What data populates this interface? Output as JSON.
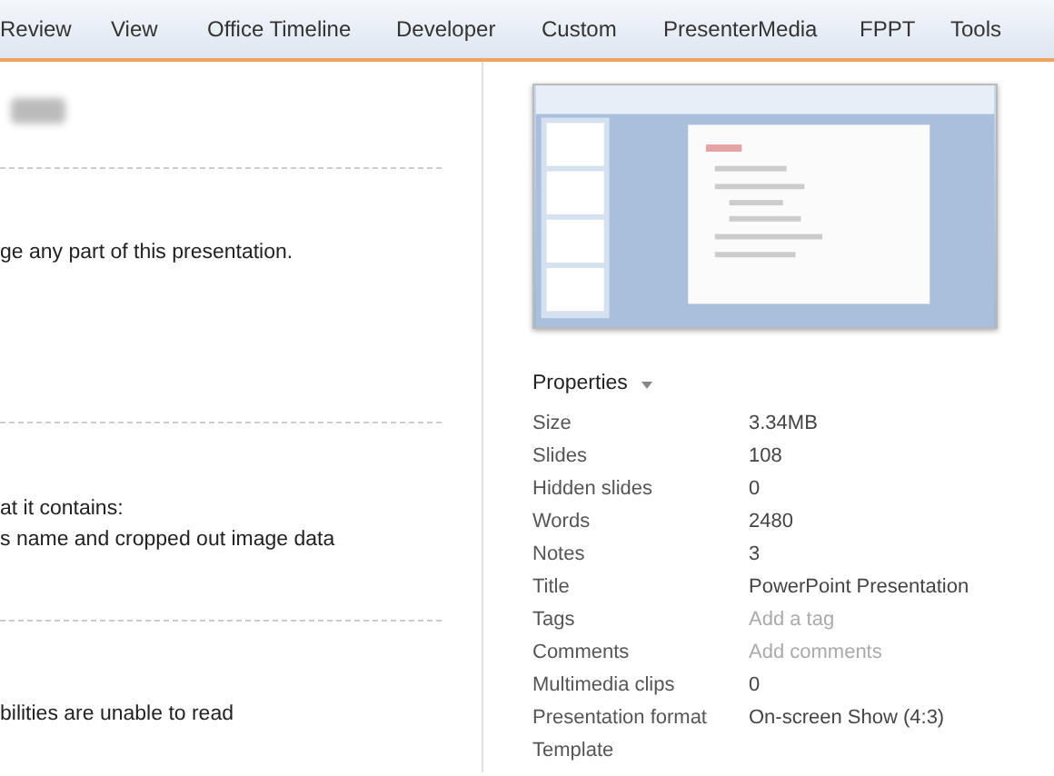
{
  "tabs": [
    {
      "label": "Review"
    },
    {
      "label": "View"
    },
    {
      "label": "Office Timeline"
    },
    {
      "label": "Developer"
    },
    {
      "label": "Custom"
    },
    {
      "label": "PresenterMedia"
    },
    {
      "label": "FPPT"
    },
    {
      "label": "Tools"
    }
  ],
  "left_pane": {
    "sections": [
      {
        "lines": [
          "ge any part of this presentation."
        ]
      },
      {
        "lines": [
          "at it contains:",
          "s name and cropped out image data"
        ]
      },
      {
        "lines": [
          "bilities are unable to read"
        ]
      }
    ]
  },
  "properties": {
    "header": "Properties",
    "rows": [
      {
        "label": "Size",
        "value": "3.34MB"
      },
      {
        "label": "Slides",
        "value": "108"
      },
      {
        "label": "Hidden slides",
        "value": "0"
      },
      {
        "label": "Words",
        "value": "2480"
      },
      {
        "label": "Notes",
        "value": "3"
      },
      {
        "label": "Title",
        "value": "PowerPoint Presentation"
      },
      {
        "label": "Tags",
        "placeholder": "Add a tag"
      },
      {
        "label": "Comments",
        "placeholder": "Add comments"
      },
      {
        "label": "Multimedia clips",
        "value": "0"
      },
      {
        "label": "Presentation format",
        "value": "On-screen Show (4:3)"
      },
      {
        "label": "Template"
      }
    ]
  }
}
